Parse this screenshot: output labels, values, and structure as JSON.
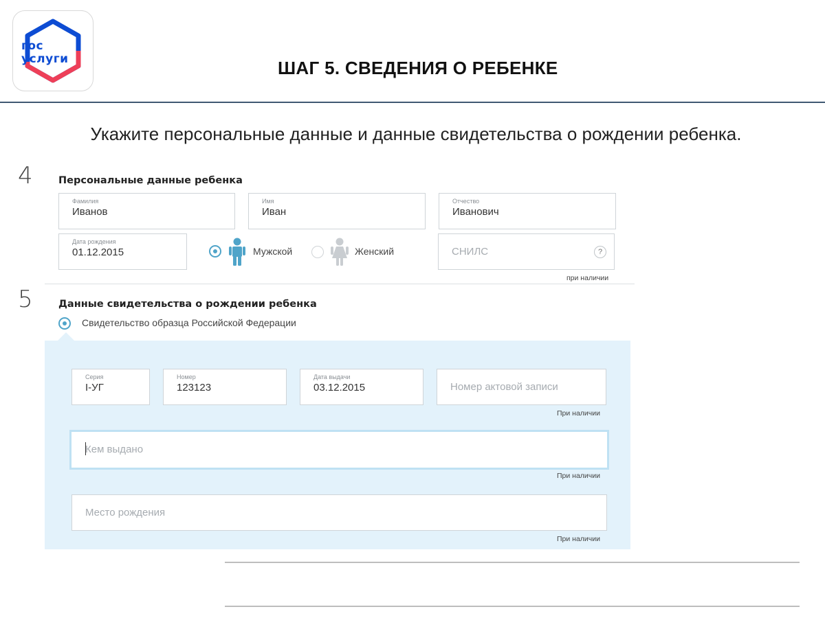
{
  "logo": {
    "line1": "гос",
    "line2": "услуги",
    "colors": {
      "blue": "#0d4cd3",
      "red": "#ee3f58"
    }
  },
  "header": {
    "title": "ШАГ 5. СВЕДЕНИЯ О РЕБЕНКЕ"
  },
  "instruction": "Укажите персональные данные и данные свидетельства о рождении ребенка.",
  "step4": {
    "number": "4",
    "title": "Персональные данные ребенка",
    "surname": {
      "label": "Фамилия",
      "value": "Иванов"
    },
    "name": {
      "label": "Имя",
      "value": "Иван"
    },
    "patronymic": {
      "label": "Отчество",
      "value": "Иванович"
    },
    "birth_date": {
      "label": "Дата рождения",
      "value": "01.12.2015"
    },
    "gender": {
      "male": "Мужской",
      "female": "Женский",
      "selected": "Мужской"
    },
    "snils": {
      "placeholder": "СНИЛС",
      "help": "?",
      "hint": "при наличии"
    }
  },
  "step5": {
    "number": "5",
    "title": "Данные свидетельства о рождении ребенка",
    "cert_type": "Свидетельство образца Российской Федерации",
    "series": {
      "label": "Серия",
      "value": "I-УГ"
    },
    "number_field": {
      "label": "Номер",
      "value": "123123"
    },
    "issue_date": {
      "label": "Дата выдачи",
      "value": "03.12.2015"
    },
    "act_record": {
      "placeholder": "Номер актовой записи",
      "hint": "При наличии"
    },
    "issued_by": {
      "placeholder": "Кем выдано",
      "hint": "При наличии"
    },
    "birth_place": {
      "placeholder": "Место рождения",
      "hint": "При наличии"
    }
  },
  "colors": {
    "accent": "#4fa4c9",
    "panel": "#e3f2fb",
    "header_line": "#3f5872"
  }
}
